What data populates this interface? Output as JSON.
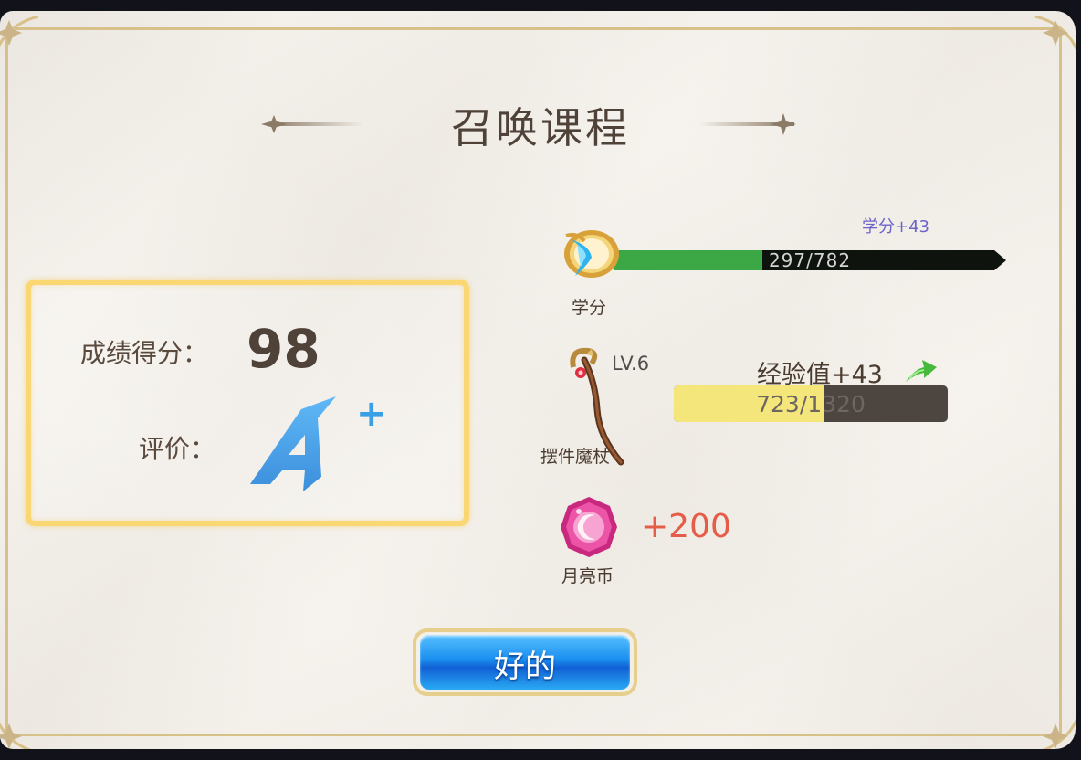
{
  "dialog": {
    "title": "召唤课程"
  },
  "score_panel": {
    "score_label": "成绩得分：",
    "score_value": "98",
    "rating_label": "评价：",
    "rating_grade": "A",
    "rating_modifier": "+"
  },
  "rewards": {
    "credit": {
      "icon": "credit-medal-icon",
      "label": "学分",
      "gain_text": "学分+43",
      "bar_text": "297/782",
      "current": 297,
      "max": 782,
      "fill_color": "#3ba845"
    },
    "item": {
      "icon": "magic-staff-icon",
      "label": "摆件魔杖",
      "level_text": "LV.6",
      "exp_gain_text": "经验值+43",
      "exp_bar_text": "723/1320",
      "exp_current": 723,
      "exp_max": 1320,
      "fill_color": "#f4e67a"
    },
    "moon_coin": {
      "icon": "moon-coin-icon",
      "label": "月亮币",
      "amount_text": "+200"
    }
  },
  "confirm_button": {
    "label": "好的"
  }
}
